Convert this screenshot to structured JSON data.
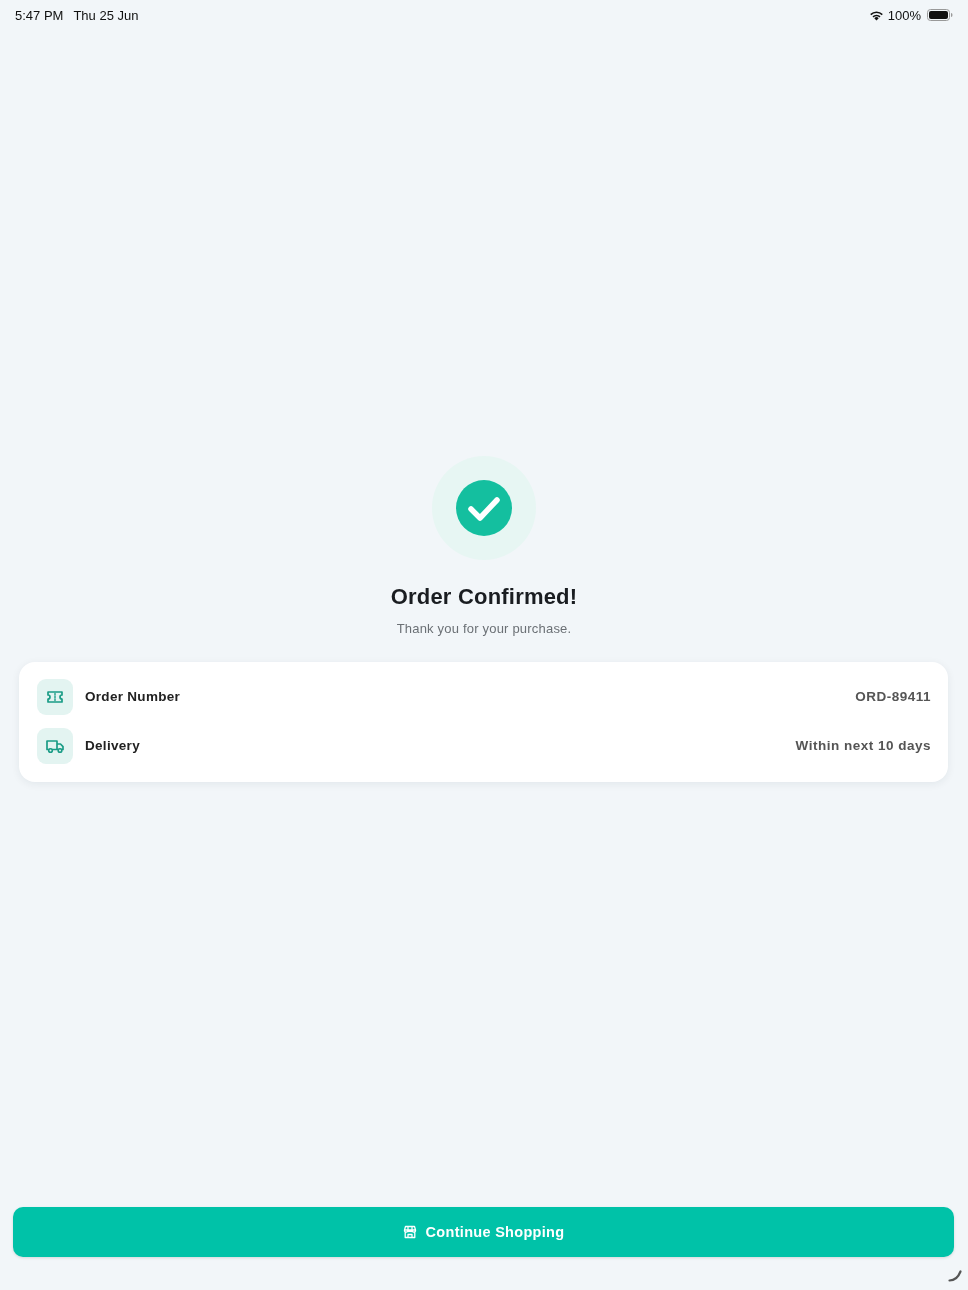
{
  "status_bar": {
    "time": "5:47 PM",
    "date": "Thu 25 Jun",
    "battery": "100%"
  },
  "confirmation": {
    "title": "Order Confirmed!",
    "subtitle": "Thank you for your purchase."
  },
  "details": [
    {
      "kind": "ticket",
      "label": "Order Number",
      "value": "ORD-89411"
    },
    {
      "kind": "truck",
      "label": "Delivery",
      "value": "Within next 10 days"
    }
  ],
  "primary_button": {
    "label": "Continue Shopping"
  }
}
